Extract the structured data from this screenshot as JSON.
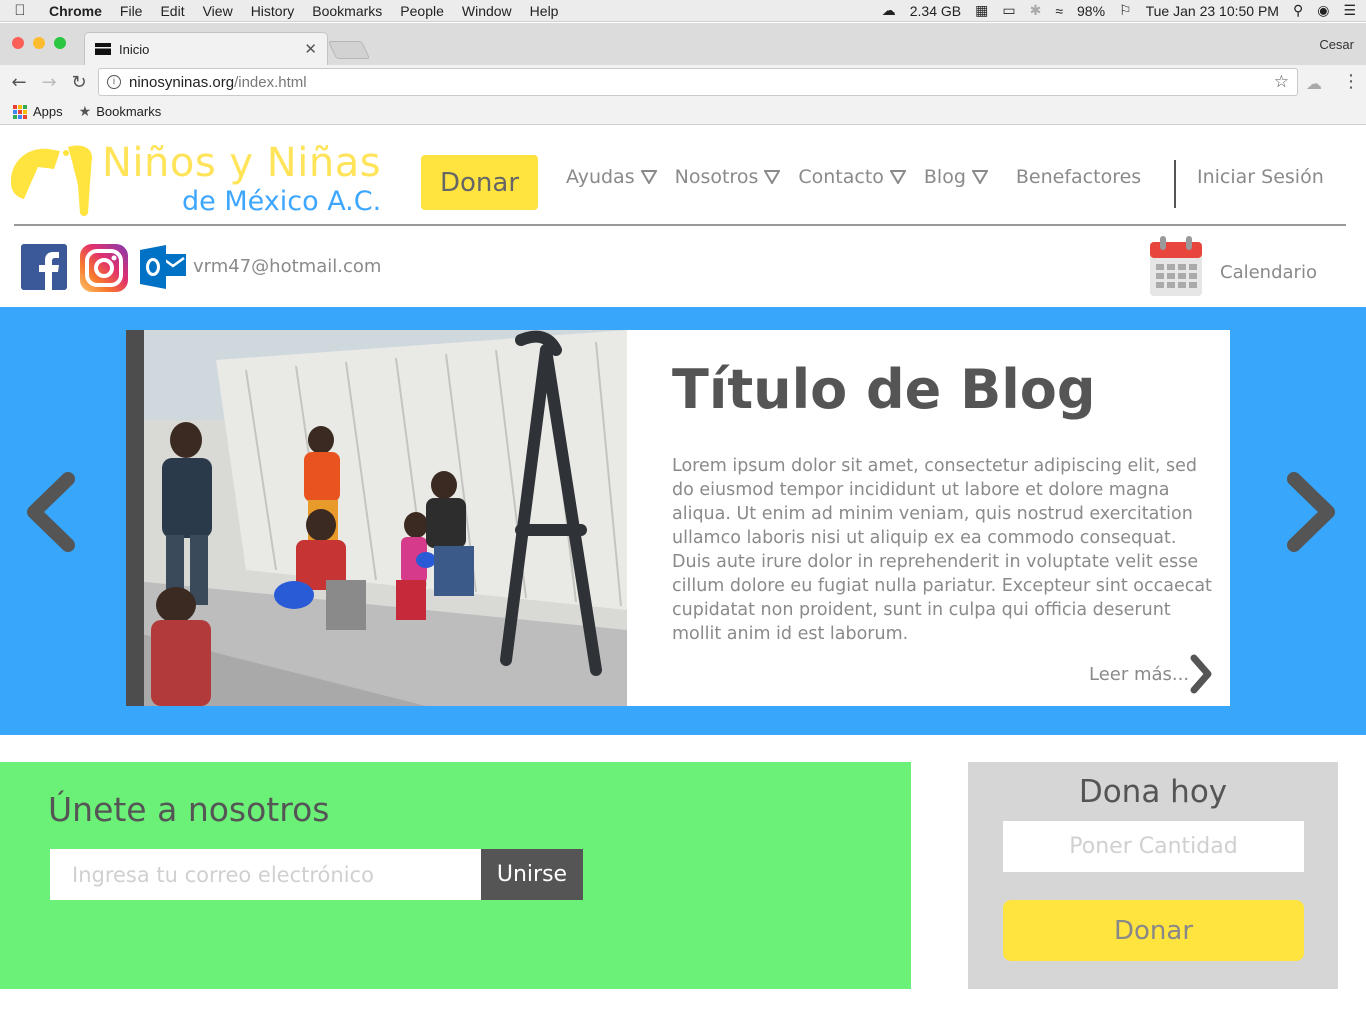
{
  "macos_menubar": {
    "app_name": "Chrome",
    "menus": [
      "File",
      "Edit",
      "View",
      "History",
      "Bookmarks",
      "People",
      "Window",
      "Help"
    ],
    "memory": "2.34 GB",
    "battery": "98%",
    "datetime": "Tue Jan 23  10:50 PM"
  },
  "browser": {
    "tab_title": "Inicio",
    "profile_name": "Cesar",
    "url_domain": "ninosyninas.org",
    "url_path": "/index.html",
    "bookmarks": {
      "apps_label": "Apps",
      "bookmarks_label": "Bookmarks"
    }
  },
  "site": {
    "logo": {
      "line1": "Niños y Niñas",
      "line2": "de México A.C."
    },
    "header_donate_label": "Donar",
    "nav": [
      {
        "label": "Ayudas",
        "has_dropdown": true
      },
      {
        "label": "Nosotros",
        "has_dropdown": true
      },
      {
        "label": "Contacto",
        "has_dropdown": true
      },
      {
        "label": "Blog",
        "has_dropdown": true
      },
      {
        "label": "Benefactores",
        "has_dropdown": false
      }
    ],
    "login_label": "Iniciar Sesión",
    "contact_email": "vrm47@hotmail.com",
    "calendar_label": "Calendario",
    "carousel": {
      "post_title": "Título de Blog",
      "post_body": "Lorem ipsum dolor sit amet, consectetur adipiscing elit, sed do eiusmod tempor incididunt ut labore et dolore magna aliqua. Ut enim ad minim veniam, quis nostrud exercitation ullamco laboris nisi ut aliquip ex ea commodo consequat. Duis aute irure dolor in reprehenderit in voluptate velit esse cillum dolore eu fugiat nulla pariatur. Excepteur sint occaecat cupidatat non proident, sunt in culpa qui officia deserunt mollit anim id est laborum.",
      "read_more_label": "Leer más..."
    },
    "join": {
      "title": "Únete a nosotros",
      "email_placeholder": "Ingresa tu correo electrónico",
      "button_label": "Unirse"
    },
    "donate_box": {
      "title": "Dona hoy",
      "amount_placeholder": "Poner Cantidad",
      "button_label": "Donar"
    }
  },
  "colors": {
    "brand_yellow": "#ffe33f",
    "brand_blue": "#37a6fb",
    "join_green": "#6bf178",
    "text_gray": "#8a8a8a",
    "dark_gray": "#555555"
  }
}
